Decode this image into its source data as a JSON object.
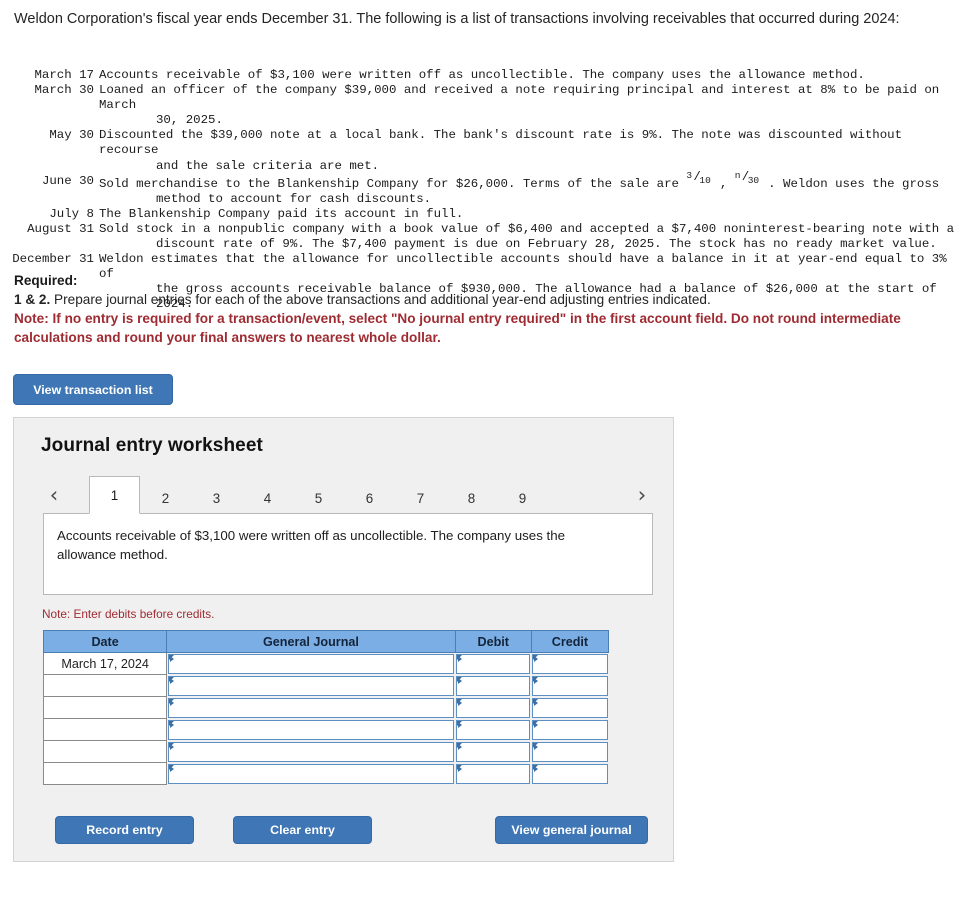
{
  "intro": "Weldon Corporation's fiscal year ends December 31. The following is a list of transactions involving receivables that occurred during 2024:",
  "transactions": [
    {
      "date": "March 17",
      "text": "Accounts receivable of $3,100 were written off as uncollectible. The company uses the allowance method.",
      "cont": ""
    },
    {
      "date": "March 30",
      "text": "Loaned an officer of the company $39,000 and received a note requiring principal and interest at 8% to be paid on March",
      "cont": "30, 2025."
    },
    {
      "date": "May 30",
      "text": "Discounted the $39,000 note at a local bank. The bank's discount rate is 9%. The note was discounted without recourse",
      "cont": "and the sale criteria are met."
    },
    {
      "date": "June 30",
      "text": "Sold merchandise to the Blankenship Company for $26,000. Terms of the sale are ",
      "frac1_num": "3",
      "frac1_den": "10",
      "mid": " , ",
      "frac2_num": "n",
      "frac2_den": "30",
      "text_after": " . Weldon uses the gross",
      "cont": "method to account for cash discounts."
    },
    {
      "date": "July 8",
      "text": "The Blankenship Company paid its account in full.",
      "cont": ""
    },
    {
      "date": "August 31",
      "text": "Sold stock in a nonpublic company with a book value of $6,400 and accepted a $7,400 noninterest-bearing note with a",
      "cont": "discount rate of 9%. The $7,400 payment is due on February 28, 2025. The stock has no ready market value."
    },
    {
      "date": "December 31",
      "text": "Weldon estimates that the allowance for uncollectible accounts should have a balance in it at year-end equal to 3% of",
      "cont": "the gross accounts receivable balance of $930,000. The allowance had a balance of $26,000 at the start of 2024."
    }
  ],
  "required": {
    "heading": "Required:",
    "line_number": "1 & 2.",
    "line_text": " Prepare journal entries for each of the above transactions and additional year-end adjusting entries indicated.",
    "note": "Note: If no entry is required for a transaction/event, select \"No journal entry required\" in the first account field. Do not round intermediate calculations and round your final answers to nearest whole dollar."
  },
  "buttons": {
    "view_transaction_list": "View transaction list",
    "record_entry": "Record entry",
    "clear_entry": "Clear entry",
    "view_general_journal": "View general journal"
  },
  "worksheet": {
    "title": "Journal entry worksheet",
    "prev_arrow": "‹",
    "next_arrow": "›",
    "tabs": [
      {
        "label": "1",
        "active": true
      },
      {
        "label": "2",
        "active": false
      },
      {
        "label": "3",
        "active": false
      },
      {
        "label": "4",
        "active": false
      },
      {
        "label": "5",
        "active": false
      },
      {
        "label": "6",
        "active": false
      },
      {
        "label": "7",
        "active": false
      },
      {
        "label": "8",
        "active": false
      },
      {
        "label": "9",
        "active": false
      }
    ],
    "prompt": "Accounts receivable of $3,100 were written off as uncollectible. The company uses the allowance method.",
    "note_debits": "Note: Enter debits before credits.",
    "table": {
      "headers": [
        "Date",
        "General Journal",
        "Debit",
        "Credit"
      ],
      "rows": [
        {
          "date": "March 17, 2024",
          "general_journal": "",
          "debit": "",
          "credit": ""
        },
        {
          "date": "",
          "general_journal": "",
          "debit": "",
          "credit": ""
        },
        {
          "date": "",
          "general_journal": "",
          "debit": "",
          "credit": ""
        },
        {
          "date": "",
          "general_journal": "",
          "debit": "",
          "credit": ""
        },
        {
          "date": "",
          "general_journal": "",
          "debit": "",
          "credit": ""
        },
        {
          "date": "",
          "general_journal": "",
          "debit": "",
          "credit": ""
        }
      ]
    }
  },
  "colors": {
    "button_blue": "#3f76b5",
    "table_header_blue": "#7aaee4",
    "note_red": "#9f2b32",
    "panel_gray": "#f0f0f0"
  }
}
